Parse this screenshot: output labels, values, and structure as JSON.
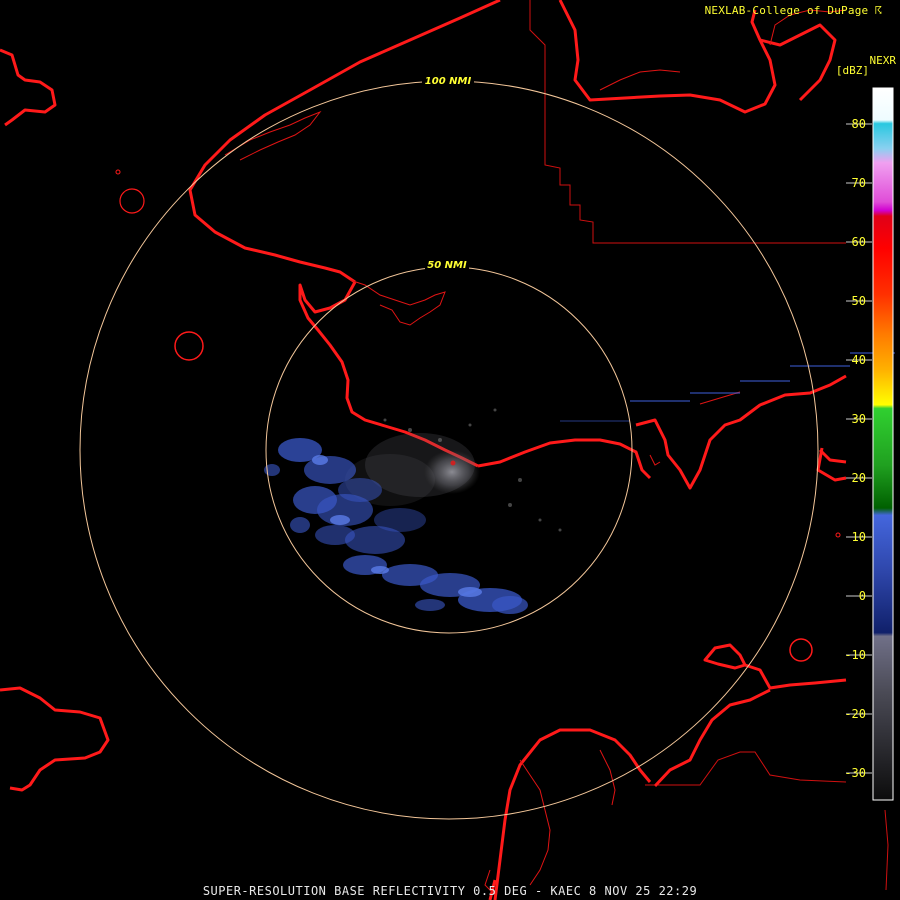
{
  "header": {
    "credit": "NEXLAB-College of DuPage ☈",
    "product_code": "NEXR",
    "unit": "[dBZ]"
  },
  "range_rings": [
    {
      "label": "50 NMI"
    },
    {
      "label": "100 NMI"
    }
  ],
  "legend": {
    "ticks": [
      "80",
      "70",
      "60",
      "50",
      "40",
      "30",
      "20",
      "10",
      "0",
      "-10",
      "-20",
      "-30"
    ],
    "label_color": "#ffff33"
  },
  "colors": {
    "coastline": "#ff1a1a",
    "ring": "#f4c79a",
    "ring_label": "#ffff33",
    "echo_light": "#3a58c8",
    "echo_gray": "#8a8a8a"
  },
  "footer": {
    "title": "SUPER-RESOLUTION BASE REFLECTIVITY 0.5 DEG - KAEC 8 NOV 25 22:29"
  }
}
